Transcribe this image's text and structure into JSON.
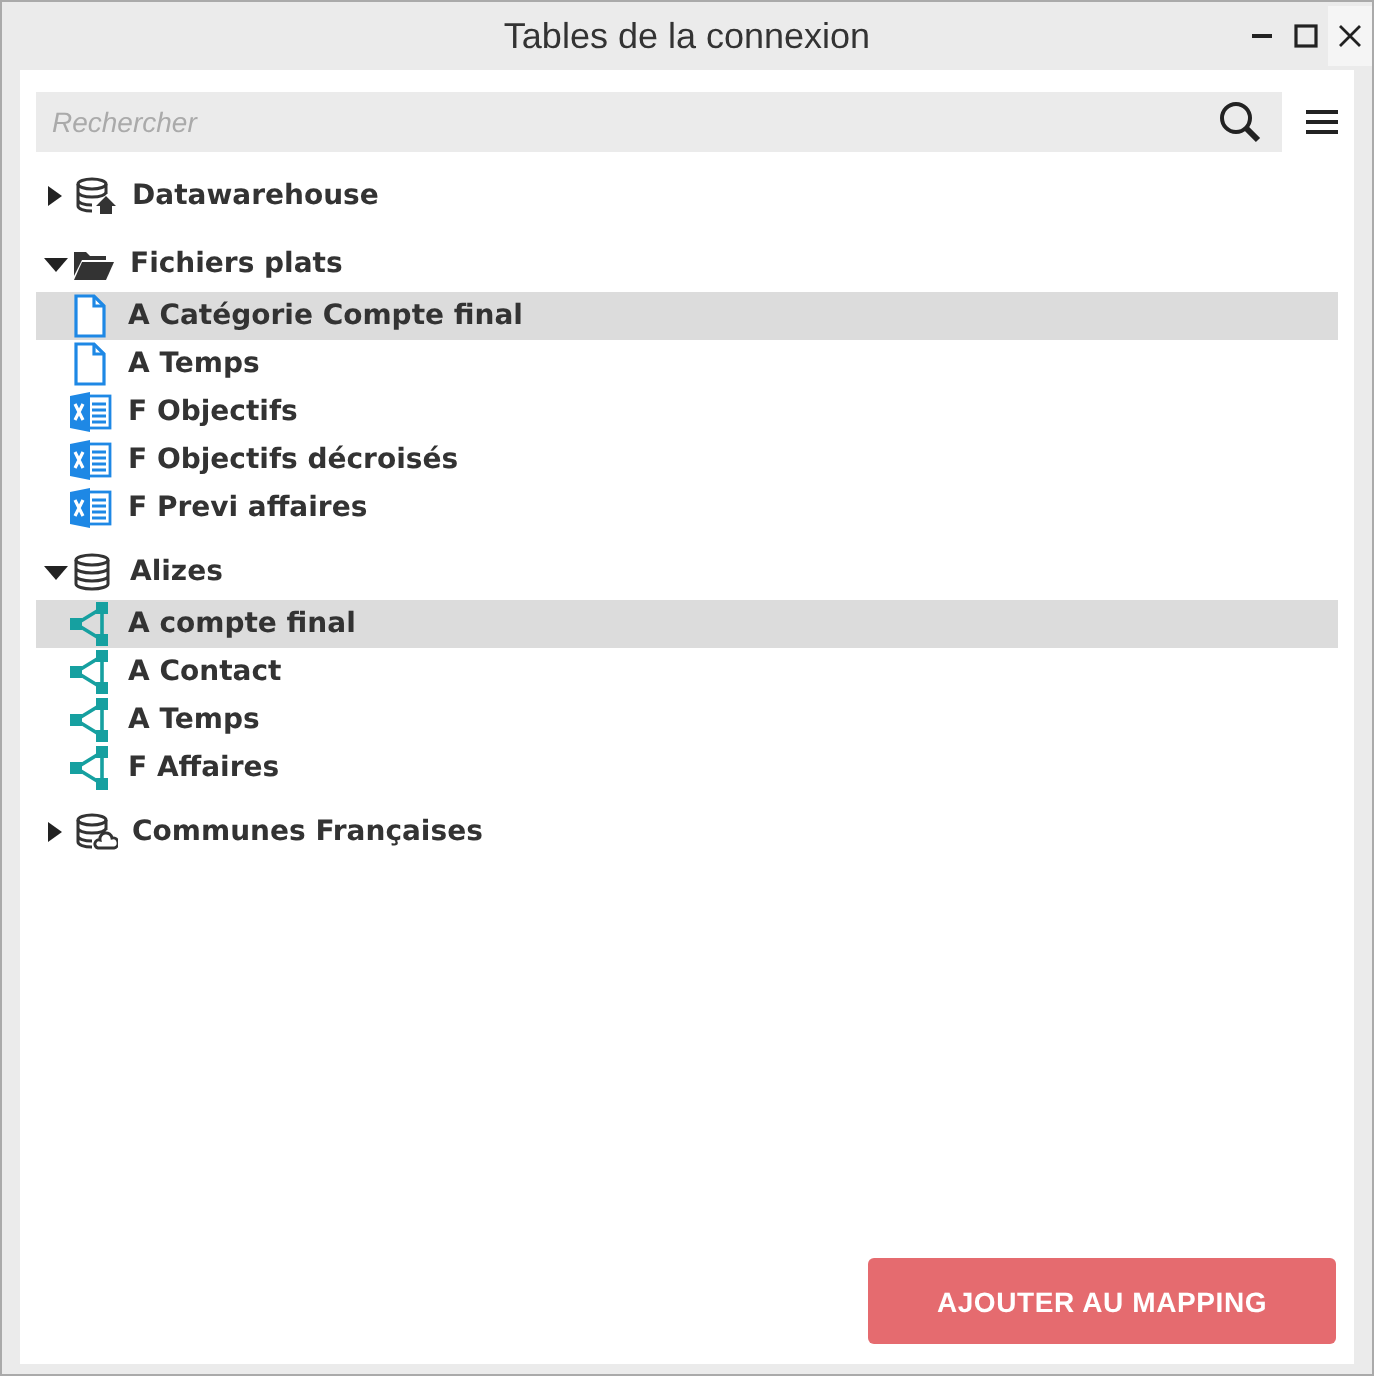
{
  "window": {
    "title": "Tables de la connexion"
  },
  "search": {
    "placeholder": "Rechercher"
  },
  "tree": [
    {
      "label": "Datawarehouse",
      "kind": "warehouse",
      "expanded": false
    },
    {
      "label": "Fichiers plats",
      "kind": "folder",
      "expanded": true,
      "children": [
        {
          "label": "A Catégorie Compte final",
          "kind": "file",
          "selected": true
        },
        {
          "label": "A Temps",
          "kind": "file",
          "selected": false
        },
        {
          "label": "F Objectifs",
          "kind": "excel",
          "selected": false
        },
        {
          "label": "F Objectifs décroisés",
          "kind": "excel",
          "selected": false
        },
        {
          "label": "F Previ affaires",
          "kind": "excel",
          "selected": false
        }
      ]
    },
    {
      "label": "Alizes",
      "kind": "database",
      "expanded": true,
      "children": [
        {
          "label": "A compte final",
          "kind": "cube",
          "selected": true
        },
        {
          "label": "A Contact",
          "kind": "cube",
          "selected": false
        },
        {
          "label": "A Temps",
          "kind": "cube",
          "selected": false
        },
        {
          "label": "F Affaires",
          "kind": "cube",
          "selected": false
        }
      ]
    },
    {
      "label": "Communes Françaises",
      "kind": "cloud",
      "expanded": false
    }
  ],
  "button": {
    "label": "AJOUTER AU MAPPING"
  }
}
